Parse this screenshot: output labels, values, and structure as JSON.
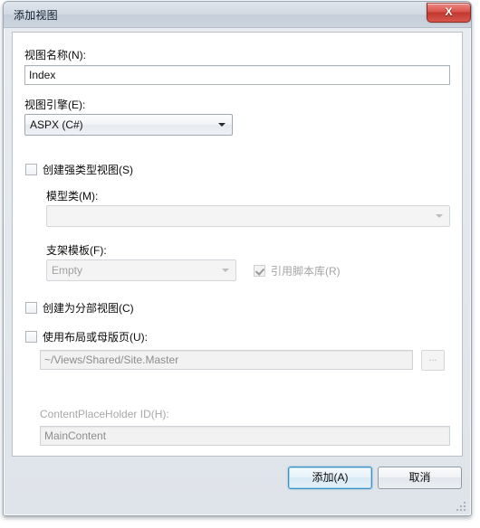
{
  "window": {
    "title": "添加视图",
    "close_label": "X",
    "accent_color": "#3c8fc0",
    "close_color": "#c0392f"
  },
  "form": {
    "view_name": {
      "label": "视图名称(N):",
      "value": "Index"
    },
    "view_engine": {
      "label": "视图引擎(E):",
      "value": "ASPX (C#)"
    },
    "strongly_typed": {
      "label": "创建强类型视图(S)",
      "checked": false
    },
    "model_class": {
      "label": "模型类(M):",
      "value": "",
      "enabled": false
    },
    "scaffold_template": {
      "label": "支架模板(F):",
      "value": "Empty",
      "enabled": false
    },
    "reference_script_libraries": {
      "label": "引用脚本库(R)",
      "checked": true,
      "enabled": false
    },
    "create_partial_view": {
      "label": "创建为分部视图(C)",
      "checked": false
    },
    "use_layout_page": {
      "label": "使用布局或母版页(U):",
      "checked": false
    },
    "layout_path": {
      "value": "~/Views/Shared/Site.Master",
      "enabled": false
    },
    "browse_button": {
      "label": "...",
      "enabled": false
    },
    "content_placeholder": {
      "label": "ContentPlaceHolder ID(H):",
      "value": "MainContent",
      "enabled": false
    }
  },
  "footer": {
    "add_label": "添加(A)",
    "cancel_label": "取消"
  }
}
